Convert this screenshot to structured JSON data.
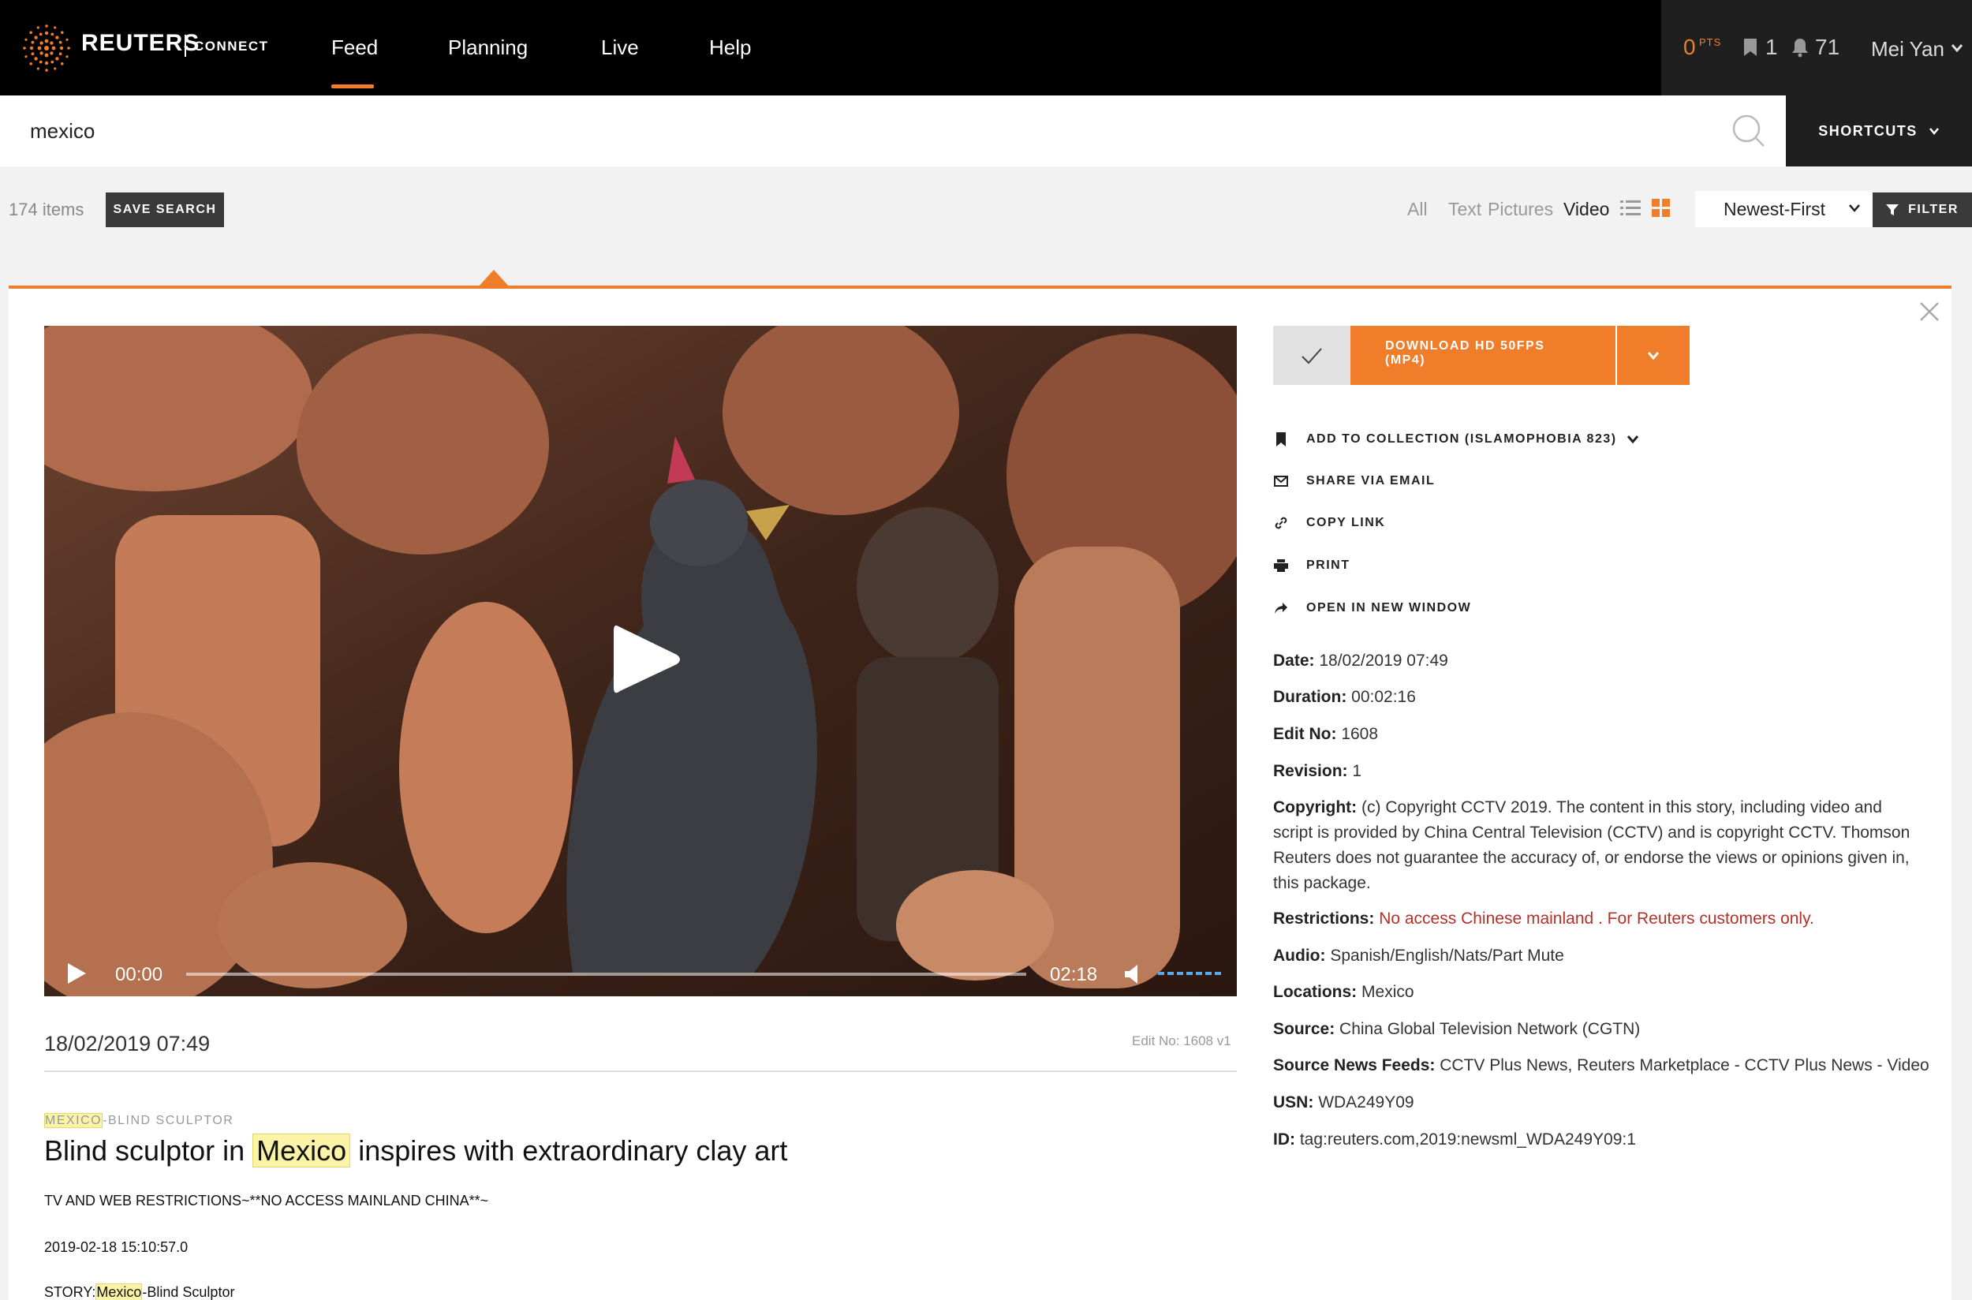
{
  "app": {
    "brand": "REUTERS",
    "brand_sub": "CONNECT",
    "logo_icon": "reuters-dot-logo-icon",
    "accent_color": "#f07d2a"
  },
  "nav": {
    "items": [
      "Feed",
      "Planning",
      "Live",
      "Help"
    ],
    "active": "Feed",
    "points": "0",
    "points_label": "PTS",
    "bookmarks": "1",
    "notifications": "71",
    "user": "Mei Yan"
  },
  "search": {
    "value": "mexico",
    "shortcuts_label": "SHORTCUTS"
  },
  "results": {
    "count_label": "174 items",
    "save_search_label": "SAVE SEARCH",
    "type_filters": [
      "All",
      "Text",
      "Pictures",
      "Video"
    ],
    "active_type": "Video",
    "sort_value": "Newest-First",
    "filter_label": "FILTER"
  },
  "player": {
    "current_time": "00:00",
    "total_time": "02:18",
    "progress": 0
  },
  "story": {
    "date": "18/02/2019 07:49",
    "edit_no": "Edit No: 1608 v1",
    "slug_highlight": "MEXICO",
    "slug_rest": "-BLIND SCULPTOR",
    "headline_before": "Blind sculptor in",
    "headline_highlight": "Mexico",
    "headline_after": "inspires with extraordinary clay art",
    "body": [
      "TV AND WEB RESTRICTIONS~**NO ACCESS MAINLAND CHINA**~",
      "2019-02-18 15:10:57.0"
    ],
    "story_label": "STORY:",
    "story_highlight": "Mexico",
    "story_rest": "-Blind Sculptor"
  },
  "download": {
    "label_line1": "DOWNLOAD HD 50FPS",
    "label_line2": "(MP4)"
  },
  "actions": [
    {
      "label": "ADD TO COLLECTION (ISLAMOPHOBIA 823)",
      "icon": "bookmark-icon"
    },
    {
      "label": "SHARE VIA EMAIL",
      "icon": "email-icon"
    },
    {
      "label": "COPY LINK",
      "icon": "link-icon"
    },
    {
      "label": "PRINT",
      "icon": "print-icon"
    },
    {
      "label": "OPEN IN NEW WINDOW",
      "icon": "share-arrow-icon"
    }
  ],
  "metadata": {
    "date_label": "Date:",
    "date": "18/02/2019 07:49",
    "duration_label": "Duration:",
    "duration": "00:02:16",
    "edit_label": "Edit No:",
    "edit": "1608",
    "revision_label": "Revision:",
    "revision": "1",
    "copyright_label": "Copyright:",
    "copyright": "(c) Copyright CCTV 2019. The content in this story, including video and script is provided by China Central Television (CCTV) and is copyright CCTV. Thomson Reuters does not guarantee the accuracy of, or endorse the views or opinions given in, this package.",
    "restrictions_label": "Restrictions:",
    "restrictions": "No access Chinese mainland . For Reuters customers only.",
    "audio_label": "Audio:",
    "audio": "Spanish/English/Nats/Part Mute",
    "locations_label": "Locations:",
    "locations": "Mexico",
    "source_label": "Source:",
    "source": "China Global Television Network (CGTN)",
    "feeds_label": "Source News Feeds:",
    "feeds": "CCTV Plus News, Reuters Marketplace - CCTV Plus News - Video",
    "usn_label": "USN:",
    "usn": "WDA249Y09",
    "id_label": "ID:",
    "id": "tag:reuters.com,2019:newsml_WDA249Y09:1"
  }
}
